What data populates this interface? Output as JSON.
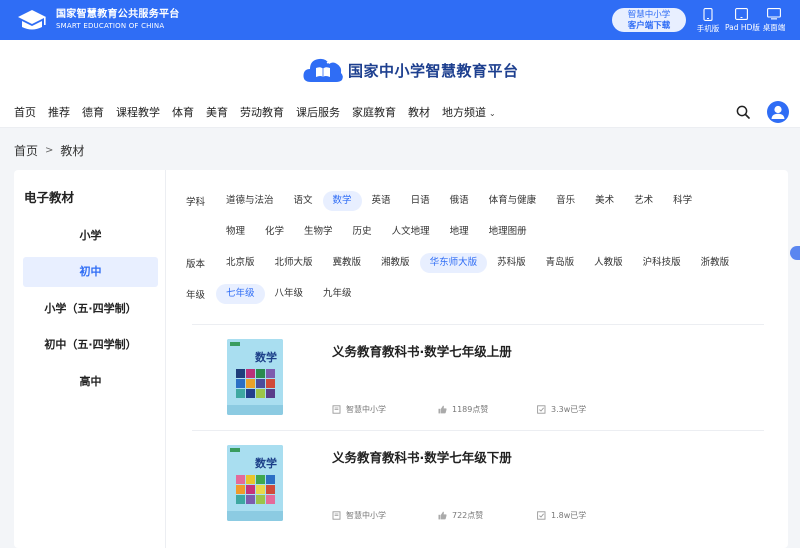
{
  "topbar": {
    "brand_cn": "国家智慧教育公共服务平台",
    "brand_en": "SMART EDUCATION OF CHINA",
    "client_line1": "智慧中小学",
    "client_line2": "客户端下载",
    "devices": [
      "手机版",
      "Pad HD版",
      "桌面端"
    ]
  },
  "header": {
    "site_title": "国家中小学智慧教育平台",
    "nav": [
      "首页",
      "推荐",
      "德育",
      "课程教学",
      "体育",
      "美育",
      "劳动教育",
      "课后服务",
      "家庭教育",
      "教材",
      "地方频道"
    ]
  },
  "breadcrumb": {
    "home": "首页",
    "sep": ">",
    "current": "教材"
  },
  "sidebar": {
    "title": "电子教材",
    "items": [
      "小学",
      "初中",
      "小学（五·四学制）",
      "初中（五·四学制）",
      "高中"
    ],
    "active_index": 1
  },
  "filters": {
    "subject_label": "学科",
    "subjects_row1": [
      "道德与法治",
      "语文",
      "数学",
      "英语",
      "日语",
      "俄语",
      "体育与健康",
      "音乐",
      "美术",
      "艺术",
      "科学"
    ],
    "subjects_row2": [
      "物理",
      "化学",
      "生物学",
      "历史",
      "人文地理",
      "地理",
      "地理图册"
    ],
    "edition_label": "版本",
    "editions": [
      "北京版",
      "北师大版",
      "冀教版",
      "湘教版",
      "华东师大版",
      "苏科版",
      "青岛版",
      "人教版",
      "沪科技版",
      "浙教版"
    ],
    "grade_label": "年级",
    "grades": [
      "七年级",
      "八年级",
      "九年级"
    ]
  },
  "books": [
    {
      "title": "义务教育教科书·数学七年级上册",
      "publisher": "智慧中小学",
      "likes": "1189点赞",
      "learned": "3.3w已学"
    },
    {
      "title": "义务教育教科书·数学七年级下册",
      "publisher": "智慧中小学",
      "likes": "722点赞",
      "learned": "1.8w已学"
    }
  ],
  "colors": {
    "primary": "#2f6df5",
    "active_bg": "#e8efff",
    "page_bg": "#f3f5f8"
  }
}
